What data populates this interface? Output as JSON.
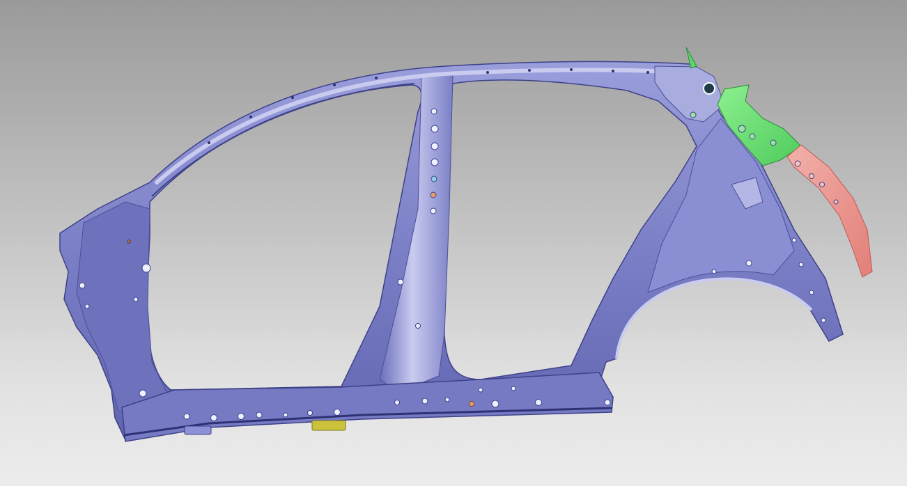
{
  "viewport": {
    "background_top": "#9a9a9a",
    "background_bottom": "#ececec"
  },
  "model": {
    "part_colors": {
      "body_side_panel": "#7b7fc6",
      "body_side_highlight": "#c9cbef",
      "body_side_shadow": "#4b4f96",
      "rear_bracket_green": "#6fe27a",
      "rear_rail_pink": "#ee9891",
      "sill_clip_yellow": "#c9c23a",
      "hole_fill": "#eef0ff",
      "hole_dark": "#2e3174"
    }
  }
}
